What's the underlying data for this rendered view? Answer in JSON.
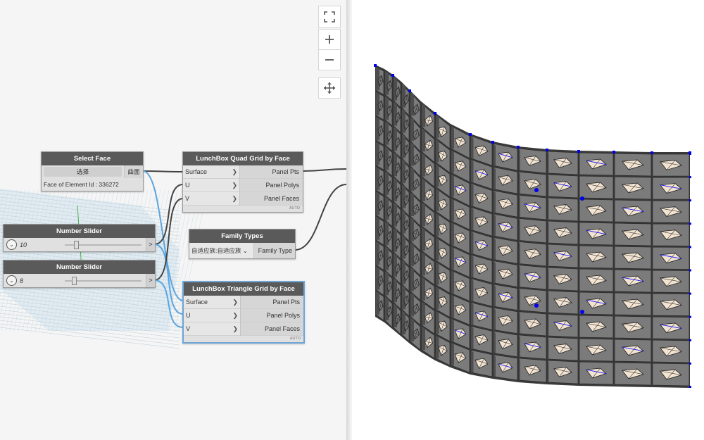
{
  "graph": {
    "nodes": {
      "select_face": {
        "title": "Select Face",
        "button": "选择",
        "output": "曲面",
        "info": "Face of Element Id : 336272"
      },
      "slider1": {
        "title": "Number Slider",
        "value": "10",
        "output": ">",
        "fraction": 0.12
      },
      "slider2": {
        "title": "Number Slider",
        "value": "8",
        "output": ">",
        "fraction": 0.09
      },
      "quad": {
        "title": "LunchBox Quad Grid by Face",
        "inputs": [
          "Surface",
          "U",
          "V"
        ],
        "outputs": [
          "Panel Pts",
          "Panel Polys",
          "Panel Faces"
        ],
        "lacing": "AUTO"
      },
      "family": {
        "title": "Family Types",
        "selected": "自适应族:自适应族",
        "output": "Family Type"
      },
      "tri": {
        "title": "LunchBox Triangle Grid by Face",
        "inputs": [
          "Surface",
          "U",
          "V"
        ],
        "outputs": [
          "Panel Pts",
          "Panel Polys",
          "Panel Faces"
        ],
        "lacing": "AUTO"
      }
    },
    "wire_color": "#444444",
    "selected_wire_color": "#5aa5e0"
  },
  "view_controls": {
    "fit_icon": "fit-view-icon",
    "zoom_in_icon": "zoom-in-icon",
    "zoom_out_icon": "zoom-out-icon",
    "pan_icon": "pan-icon"
  },
  "viewport": {
    "panel_grid": {
      "columns": 15,
      "rows": 10
    },
    "colors": {
      "panel": "#7b7b7b",
      "side": "#4e4e4e",
      "opening": "#f3e4d2",
      "point": "#0000ee",
      "curve": "#2020ff"
    }
  }
}
